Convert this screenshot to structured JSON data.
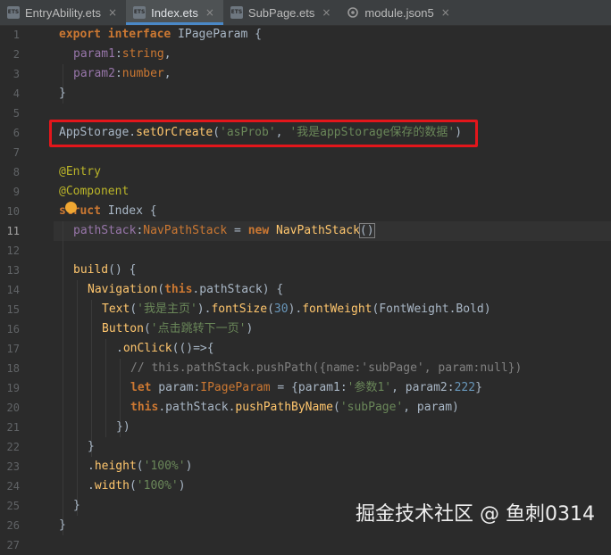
{
  "tabs": [
    {
      "name": "EntryAbility.ets",
      "close": "×"
    },
    {
      "name": "Index.ets",
      "close": "×"
    },
    {
      "name": "SubPage.ets",
      "close": "×"
    },
    {
      "name": "module.json5",
      "close": "×"
    }
  ],
  "line_numbers": [
    "1",
    "2",
    "3",
    "4",
    "5",
    "6",
    "7",
    "8",
    "9",
    "10",
    "11",
    "12",
    "13",
    "14",
    "15",
    "16",
    "17",
    "18",
    "19",
    "20",
    "21",
    "22",
    "23",
    "24",
    "25",
    "26",
    "27"
  ],
  "code": {
    "l1": {
      "kw": "export interface",
      "name": " IPageParam {"
    },
    "l2": {
      "prop": "param1",
      "colon": ":",
      "type": "string",
      "end": ","
    },
    "l3": {
      "prop": "param2",
      "colon": ":",
      "type": "number",
      "end": ","
    },
    "l4": {
      "text": "}"
    },
    "l6": {
      "cls": "AppStorage",
      "dot": ".",
      "fn": "setOrCreate",
      "open": "(",
      "s1": "'asProb'",
      "comma": ", ",
      "s2": "'我是appStorage保存的数据'",
      "close": ")"
    },
    "l8": {
      "ann": "@Entry"
    },
    "l9": {
      "ann": "@Component"
    },
    "l10": {
      "kw": "struct",
      "name": " Index {"
    },
    "l11": {
      "prop": "pathStack",
      "colon": ":",
      "type": "NavPathStack",
      "eq": " = ",
      "kw": "new",
      "cls": " NavPathStack",
      "paren": "()"
    },
    "l13": {
      "fn": "build",
      "rest": "() {"
    },
    "l14": {
      "fn": "Navigation",
      "open": "(",
      "kw": "this",
      "rest": ".pathStack) {"
    },
    "l15": {
      "fn": "Text",
      "open": "(",
      "s1": "'我是主页'",
      "mid": ").",
      "fn2": "fontSize",
      "o2": "(",
      "n1": "30",
      "c2": ").",
      "fn3": "fontWeight",
      "o3": "(",
      "arg": "FontWeight.Bold",
      "end": ")"
    },
    "l16": {
      "fn": "Button",
      "open": "(",
      "s1": "'点击跳转下一页'",
      "end": ")"
    },
    "l17": {
      "dot": ".",
      "fn": "onClick",
      "rest": "(()=>{"
    },
    "l18": {
      "cmt": "// this.pathStack.pushPath({name:'subPage', param:null})"
    },
    "l19": {
      "kw": "let",
      "v": " param:",
      "type": "IPageParam",
      "eq": " = {param1:",
      "s1": "'参数1'",
      "mid": ", param2:",
      "n1": "222",
      "end": "}"
    },
    "l20": {
      "kw": "this",
      "rest": ".pathStack.",
      "fn": "pushPathByName",
      "open": "(",
      "s1": "'subPage'",
      "end": ", param)"
    },
    "l21": {
      "text": "})"
    },
    "l22": {
      "text": "}"
    },
    "l23": {
      "dot": ".",
      "fn": "height",
      "open": "(",
      "s1": "'100%'",
      "end": ")"
    },
    "l24": {
      "dot": ".",
      "fn": "width",
      "open": "(",
      "s1": "'100%'",
      "end": ")"
    },
    "l25": {
      "text": "}"
    },
    "l26": {
      "text": "}"
    }
  },
  "watermark": "掘金技术社区 @ 鱼刺0314",
  "colors": {
    "highlight_box": "#e3161b",
    "background": "#2b2b2b",
    "tab_active_underline": "#4a88c7",
    "intention_bulb": "#f0a732"
  }
}
